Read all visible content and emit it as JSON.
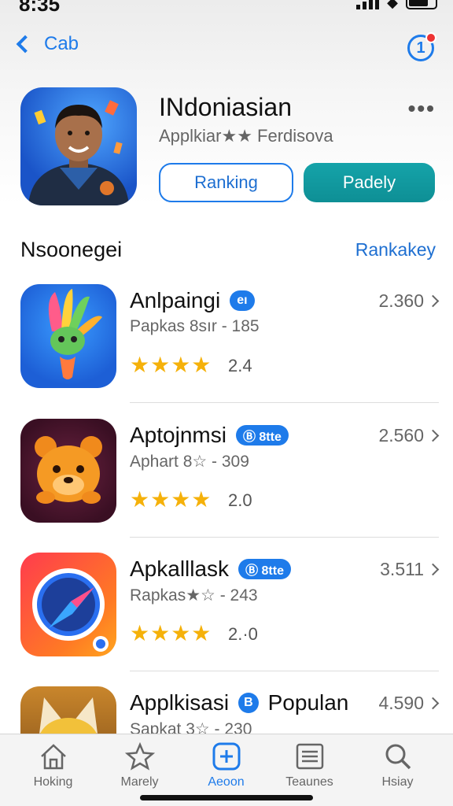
{
  "status": {
    "time": "8:35"
  },
  "nav": {
    "back_label": "Cab",
    "notification_count": "1"
  },
  "hero": {
    "title": "INdoniasian",
    "subtitle": "Applkiar★★ Ferdisova",
    "more": "•••",
    "btn_outline": "Ranking",
    "btn_fill": "Padely",
    "colors": {
      "accent": "#1e7bea",
      "teal": "#0e8f95"
    }
  },
  "section": {
    "title": "Nsoonegei",
    "link": "Rankakey"
  },
  "apps": [
    {
      "name": "Anlpaingi",
      "badge": "eı",
      "meta": "Papkas 8sır - 185",
      "stars": "★★★★",
      "rating": "2.4",
      "count": "2.360",
      "icon": "feather-creature-icon"
    },
    {
      "name": "Aptojnmsi",
      "badge": "Ⓑ 8tte",
      "meta": "Aphart 8☆ - 309",
      "stars": "★★★★",
      "rating": "2.0",
      "count": "2.560",
      "icon": "bear-icon"
    },
    {
      "name": "Apkalllask",
      "badge": "Ⓑ 8tte",
      "meta": "Rapkas★☆ - 243",
      "stars": "★★★★",
      "rating": "2.·0",
      "count": "3.511",
      "icon": "compass-icon"
    },
    {
      "name": "Applkisasi",
      "badge": "B",
      "badge_text": "Populan",
      "meta": "Sapkat 3☆ - 230",
      "stars": "",
      "rating": "",
      "count": "4.590",
      "icon": "fox-icon"
    }
  ],
  "tabs": [
    {
      "label": "Hoking",
      "icon": "house-icon"
    },
    {
      "label": "Marely",
      "icon": "star-icon"
    },
    {
      "label": "Aeoon",
      "icon": "plus-square-icon"
    },
    {
      "label": "Teaunes",
      "icon": "list-icon"
    },
    {
      "label": "Hsiay",
      "icon": "search-icon"
    }
  ]
}
